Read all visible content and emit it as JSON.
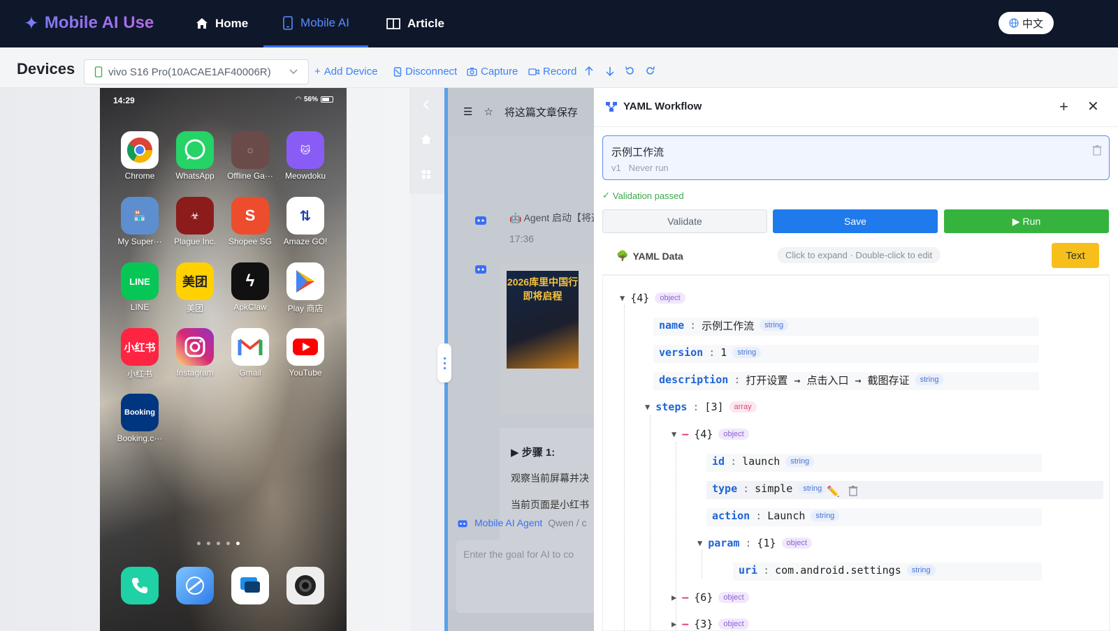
{
  "nav": {
    "brand": "Mobile AI Use",
    "home": "Home",
    "mobile_ai": "Mobile AI",
    "article": "Article",
    "lang": "中文"
  },
  "toolbar": {
    "title": "Devices",
    "device": "vivo S16 Pro(10ACAE1AF40006R)",
    "add_device": "Add Device",
    "disconnect": "Disconnect",
    "capture": "Capture",
    "record": "Record"
  },
  "phone": {
    "time": "14:29",
    "battery": "56%",
    "apps": [
      {
        "label": "Chrome",
        "color": "#ffffff"
      },
      {
        "label": "WhatsApp",
        "color": "#25d366"
      },
      {
        "label": "Offline Ga···",
        "color": "#6b4a4a"
      },
      {
        "label": "Meowdoku",
        "color": "#8a5cf6"
      },
      {
        "label": "My Super···",
        "color": "#5d8fd0"
      },
      {
        "label": "Plague Inc.",
        "color": "#8c1c1c"
      },
      {
        "label": "Shopee SG",
        "color": "#ee4d2d"
      },
      {
        "label": "Amaze GO!",
        "color": "#ffffff"
      },
      {
        "label": "LINE",
        "color": "#06c755"
      },
      {
        "label": "美团",
        "color": "#ffd100"
      },
      {
        "label": "ApkClaw",
        "color": "#111111"
      },
      {
        "label": "Play 商店",
        "color": "#ffffff"
      },
      {
        "label": "小红书",
        "color": "#ff2442"
      },
      {
        "label": "Instagram",
        "color": "#d62976"
      },
      {
        "label": "Gmail",
        "color": "#ffffff"
      },
      {
        "label": "YouTube",
        "color": "#ffffff"
      },
      {
        "label": "Booking.c···",
        "color": "#003580"
      }
    ],
    "dock": [
      {
        "name": "phone-app",
        "color": "#1fd1a5"
      },
      {
        "name": "browser-app",
        "color": "#4aa3f5"
      },
      {
        "name": "messages-app",
        "color": "#ffffff"
      },
      {
        "name": "camera-app",
        "color": "#eeeeee"
      }
    ]
  },
  "chat": {
    "header_title": "将这篇文章保存",
    "agent_msg": "Agent 启动【将这",
    "time": "17:36",
    "poster_title": "2026库里中国行 即将启程",
    "step_title": "步骤 1:",
    "step_line1": "观察当前屏幕并决",
    "step_line2": "当前页面是小红书",
    "agent_label": "Mobile AI Agent",
    "agent_model": "Qwen / c",
    "input_placeholder": "Enter the goal for AI to co"
  },
  "yaml_panel": {
    "title": "YAML Workflow",
    "workflow_name": "示例工作流",
    "workflow_version": "v1",
    "workflow_status": "Never run",
    "validation": "Validation passed",
    "validate_btn": "Validate",
    "save_btn": "Save",
    "run_btn": "Run",
    "data_title": "YAML Data",
    "hint": "Click to expand · Double-click to edit",
    "text_btn": "Text"
  },
  "tree": {
    "root_count": "{4}",
    "object": "object",
    "string": "string",
    "array": "array",
    "name_key": "name",
    "name_val": "示例工作流",
    "version_key": "version",
    "version_val": "1",
    "desc_key": "description",
    "desc_val": "打开设置 → 点击入口 → 截图存证",
    "steps_key": "steps",
    "steps_count": "[3]",
    "step1_count": "{4}",
    "id_key": "id",
    "id_val": "launch",
    "type_key": "type",
    "type_val": "simple",
    "action_key": "action",
    "action_val": "Launch",
    "param_key": "param",
    "param_count": "{1}",
    "uri_key": "uri",
    "uri_val": "com.android.settings",
    "step2_count": "{6}",
    "step3_count": "{3}"
  }
}
